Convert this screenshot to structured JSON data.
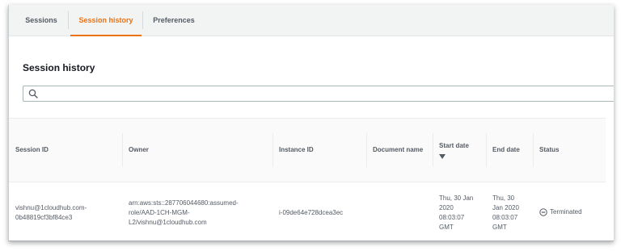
{
  "tabs": [
    {
      "label": "Sessions"
    },
    {
      "label": "Session history"
    },
    {
      "label": "Preferences"
    }
  ],
  "active_tab_color": "#ec7211",
  "page": {
    "title": "Session history",
    "search": {
      "placeholder": "",
      "value": "",
      "icon": "search-icon"
    }
  },
  "table": {
    "columns": {
      "session_id": "Session ID",
      "owner": "Owner",
      "instance_id": "Instance ID",
      "document_name": "Document name",
      "start_date": "Start date",
      "end_date": "End date",
      "status": "Status"
    },
    "sorted_by": "start_date",
    "sort_direction": "descending",
    "rows": [
      {
        "session_id": "vishnu@1cloudhub.com-0b48819cf3bf84ce3",
        "owner": "arn:aws:sts::287706044680:assumed-role/AAD-1CH-MGM-L2/vishnu@1cloudhub.com",
        "instance_id": "i-09de64e728dcea3ec",
        "document_name": "",
        "start_date": "Thu, 30 Jan 2020 08:03:07 GMT",
        "end_date": "Thu, 30 Jan 2020 08:03:07 GMT",
        "status": "Terminated",
        "status_icon": "terminated-icon"
      }
    ]
  }
}
